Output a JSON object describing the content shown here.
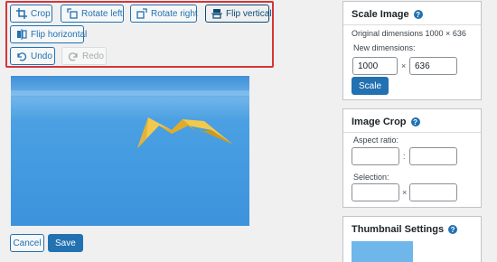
{
  "toolbar": {
    "crop": "Crop",
    "rotate_left": "Rotate left",
    "rotate_right": "Rotate right",
    "flip_vertical": "Flip vertical",
    "flip_horizontal": "Flip horizontal",
    "undo": "Undo",
    "redo": "Redo"
  },
  "actions": {
    "cancel": "Cancel",
    "save": "Save"
  },
  "scale": {
    "title": "Scale Image",
    "original": "Original dimensions 1000 × 636",
    "new_label": "New dimensions:",
    "width": "1000",
    "times": "×",
    "height": "636",
    "button": "Scale"
  },
  "crop_panel": {
    "title": "Image Crop",
    "aspect_label": "Aspect ratio:",
    "aspect_sep": ":",
    "selection_label": "Selection:",
    "selection_sep": "×"
  },
  "thumb_panel": {
    "title": "Thumbnail Settings"
  },
  "help_glyph": "?",
  "colors": {
    "accent": "#2271b1",
    "highlight": "#d63638",
    "sky": "#4a9de0",
    "plane": "#f2c94c"
  }
}
